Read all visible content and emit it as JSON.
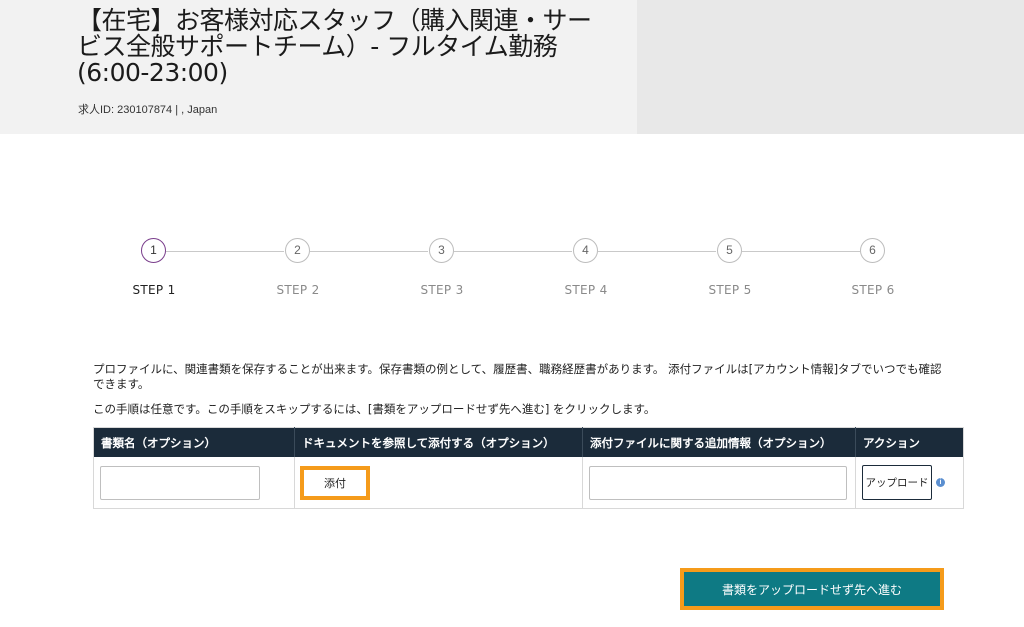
{
  "header": {
    "job_title": "【在宅】お客様対応スタッフ（購入関連・サービス全般サポートチーム）- フルタイム勤務(6:00-23:00)",
    "job_meta": "求人ID: 230107874 | , Japan"
  },
  "stepper": {
    "current_step": 1,
    "steps": [
      {
        "number": "1",
        "label": "STEP 1"
      },
      {
        "number": "2",
        "label": "STEP 2"
      },
      {
        "number": "3",
        "label": "STEP 3"
      },
      {
        "number": "4",
        "label": "STEP 4"
      },
      {
        "number": "5",
        "label": "STEP 5"
      },
      {
        "number": "6",
        "label": "STEP 6"
      }
    ]
  },
  "instructions": {
    "description": "プロファイルに、関連書類を保存することが出来ます。保存書類の例として、履歴書、職務経歴書があります。 添付ファイルは[アカウント情報]タブでいつでも確認できます。",
    "optional_note": "この手順は任意です。この手順をスキップするには、[書類をアップロードせず先へ進む] をクリックします。"
  },
  "documents_table": {
    "columns": [
      "書類名（オプション）",
      "ドキュメントを参照して添付する（オプション）",
      "添付ファイルに関する追加情報（オプション）",
      "アクション"
    ],
    "row": {
      "name_value": "",
      "attach_label": "添付",
      "info_value": "",
      "upload_label": "アップロード",
      "info_icon": "i"
    }
  },
  "footer": {
    "proceed_label": "書類をアップロードせず先へ進む"
  },
  "colors": {
    "header_dark": "#1b2b3a",
    "accent_teal": "#0e7a84",
    "highlight_orange": "#f59b1a",
    "active_step": "#7a3e8c"
  }
}
